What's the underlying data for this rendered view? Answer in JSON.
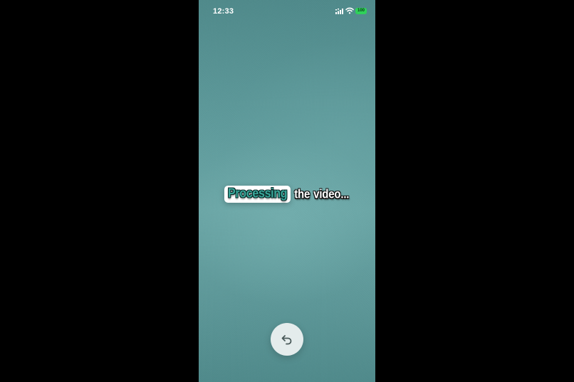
{
  "status_bar": {
    "time": "12:33",
    "battery_level": "100",
    "icons": [
      "cellular-signal-icon",
      "wifi-icon",
      "battery-icon"
    ]
  },
  "caption": {
    "highlighted_word": "Processing",
    "words": [
      "the",
      "video..."
    ]
  },
  "back_button": {
    "icon": "undo-arrow-icon"
  },
  "colors": {
    "background_teal": "#5f9c9d",
    "highlight_text": "#3aa79a",
    "battery_green": "#2fd15a",
    "button_bg": "#e4ecec"
  }
}
